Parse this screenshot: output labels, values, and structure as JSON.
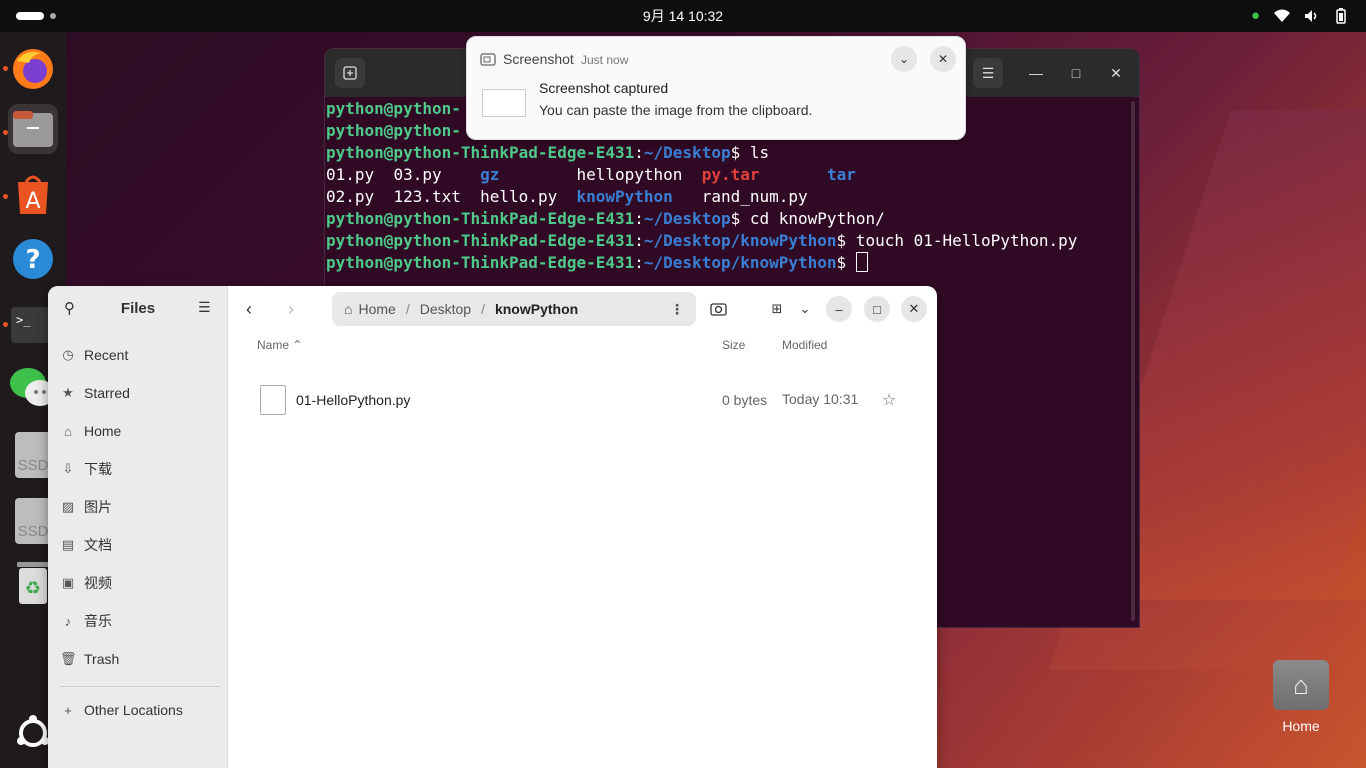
{
  "topbar": {
    "datetime": "9月 14  10:32"
  },
  "dock": {
    "items": [
      {
        "name": "firefox",
        "icon": "firefox-icon"
      },
      {
        "name": "files",
        "icon": "files-icon"
      },
      {
        "name": "app-center",
        "icon": "app-center-icon"
      },
      {
        "name": "help",
        "icon": "help-icon"
      },
      {
        "name": "terminal",
        "icon": "terminal-icon"
      },
      {
        "name": "wechat",
        "icon": "wechat-icon"
      },
      {
        "name": "ssd-1",
        "label": "SSD"
      },
      {
        "name": "ssd-2",
        "label": "SSD"
      },
      {
        "name": "trash",
        "icon": "trash-icon"
      },
      {
        "name": "show-apps",
        "icon": "ubuntu-icon"
      }
    ]
  },
  "terminal": {
    "lines": [
      {
        "prompt": "python@python-",
        "path": "",
        "cmd": ""
      },
      {
        "prompt": "python@python-",
        "path": "",
        "cmd": ""
      },
      {
        "prompt": "python@python-ThinkPad-Edge-E431",
        "path": "~/Desktop",
        "cmd": " ls"
      },
      {
        "prompt": "python@python-ThinkPad-Edge-E431",
        "path": "~/Desktop",
        "cmd": " cd knowPython/"
      },
      {
        "prompt": "python@python-ThinkPad-Edge-E431",
        "path": "~/Desktop/knowPython",
        "cmd": " touch 01-HelloPython.py"
      },
      {
        "prompt": "python@python-ThinkPad-Edge-E431",
        "path": "~/Desktop/knowPython",
        "cmd": " "
      }
    ],
    "ls_row1": [
      "01.py",
      "03.py",
      "gz",
      "hellopython",
      "py.tar",
      "tar"
    ],
    "ls_row2": [
      "02.py",
      "123.txt",
      "hello.py",
      "knowPython",
      "rand_num.py"
    ]
  },
  "notification": {
    "app": "Screenshot",
    "when": "Just now",
    "title": "Screenshot captured",
    "body": "You can paste the image from the clipboard."
  },
  "files": {
    "sidebar_title": "Files",
    "sidebar": [
      {
        "label": "Recent",
        "icon": "clock-icon"
      },
      {
        "label": "Starred",
        "icon": "star-icon"
      },
      {
        "label": "Home",
        "icon": "home-icon"
      },
      {
        "label": "下载",
        "icon": "download-icon"
      },
      {
        "label": "图片",
        "icon": "image-icon"
      },
      {
        "label": "文档",
        "icon": "document-icon"
      },
      {
        "label": "视频",
        "icon": "video-icon"
      },
      {
        "label": "音乐",
        "icon": "music-icon"
      },
      {
        "label": "Trash",
        "icon": "trash-icon"
      },
      {
        "label": "Other Locations",
        "icon": "plus-icon"
      }
    ],
    "path": [
      "Home",
      "Desktop",
      "knowPython"
    ],
    "columns": {
      "name": "Name",
      "size": "Size",
      "modified": "Modified"
    },
    "rows": [
      {
        "name": "01-HelloPython.py",
        "size": "0 bytes",
        "modified": "Today 10:31"
      }
    ]
  },
  "desktop": {
    "home_label": "Home"
  }
}
